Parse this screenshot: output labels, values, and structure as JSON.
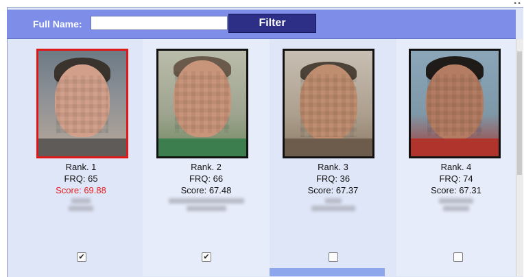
{
  "filter": {
    "label": "Full Name:",
    "input_value": "",
    "button_label": "Filter"
  },
  "results": [
    {
      "rank": "Rank. 1",
      "frq": "FRQ: 65",
      "score": "Score: 69.88",
      "selected_photo": true,
      "checked": true
    },
    {
      "rank": "Rank. 2",
      "frq": "FRQ: 66",
      "score": "Score: 67.48",
      "selected_photo": false,
      "checked": true
    },
    {
      "rank": "Rank. 3",
      "frq": "FRQ: 36",
      "score": "Score: 67.37",
      "selected_photo": false,
      "checked": false
    },
    {
      "rank": "Rank. 4",
      "frq": "FRQ: 74",
      "score": "Score: 67.31",
      "selected_photo": false,
      "checked": false
    }
  ],
  "colors": {
    "filterbar": "#7e8ee8",
    "filter_button": "#2d2f86",
    "selected_border": "#e01818",
    "selected_score": "#e51d1d"
  },
  "icons": {
    "checkbox_checked": "checkmark-icon"
  }
}
